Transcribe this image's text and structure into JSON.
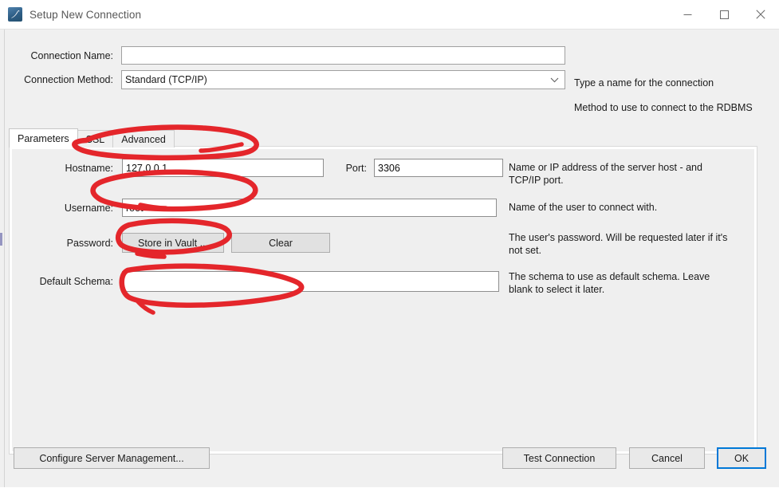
{
  "window": {
    "title": "Setup New Connection",
    "app_icon": "mysql-dolphin-icon",
    "controls": {
      "minimize": "minimize-icon",
      "maximize": "maximize-icon",
      "close": "close-icon"
    }
  },
  "form": {
    "connection_name": {
      "label": "Connection Name:",
      "value": "",
      "placeholder": "",
      "hint": "Type a name for the connection"
    },
    "connection_method": {
      "label": "Connection Method:",
      "value": "Standard (TCP/IP)",
      "options": [
        "Standard (TCP/IP)"
      ],
      "hint": "Method to use to connect to the RDBMS",
      "arrow_icon": "chevron-down-icon"
    }
  },
  "tabs": [
    {
      "label": "Parameters",
      "active": true
    },
    {
      "label": "SSL",
      "active": false
    },
    {
      "label": "Advanced",
      "active": false
    }
  ],
  "parameters": {
    "hostname": {
      "label": "Hostname:",
      "value": "127.0.0.1"
    },
    "port": {
      "label": "Port:",
      "value": "3306"
    },
    "host_hint": "Name or IP address of the server host - and\nTCP/IP port.",
    "username": {
      "label": "Username:",
      "value": "root",
      "hint": "Name of the user to connect with."
    },
    "password": {
      "label": "Password:",
      "store_button": "Store in Vault ...",
      "clear_button": "Clear",
      "hint": "The user's password. Will be requested later if it's\nnot set."
    },
    "default_schema": {
      "label": "Default Schema:",
      "value": "",
      "hint": "The schema to use as default schema. Leave\nblank to select it later."
    }
  },
  "footer": {
    "configure_server_management": "Configure Server Management...",
    "test_connection": "Test Connection",
    "cancel": "Cancel",
    "ok": "OK"
  },
  "annotations": {
    "color": "#E4262B",
    "marks": [
      "ellipse-around-hostname-field",
      "ellipse-around-username-field",
      "ellipse-around-store-in-vault-button",
      "ellipse-around-default-schema-field"
    ]
  }
}
